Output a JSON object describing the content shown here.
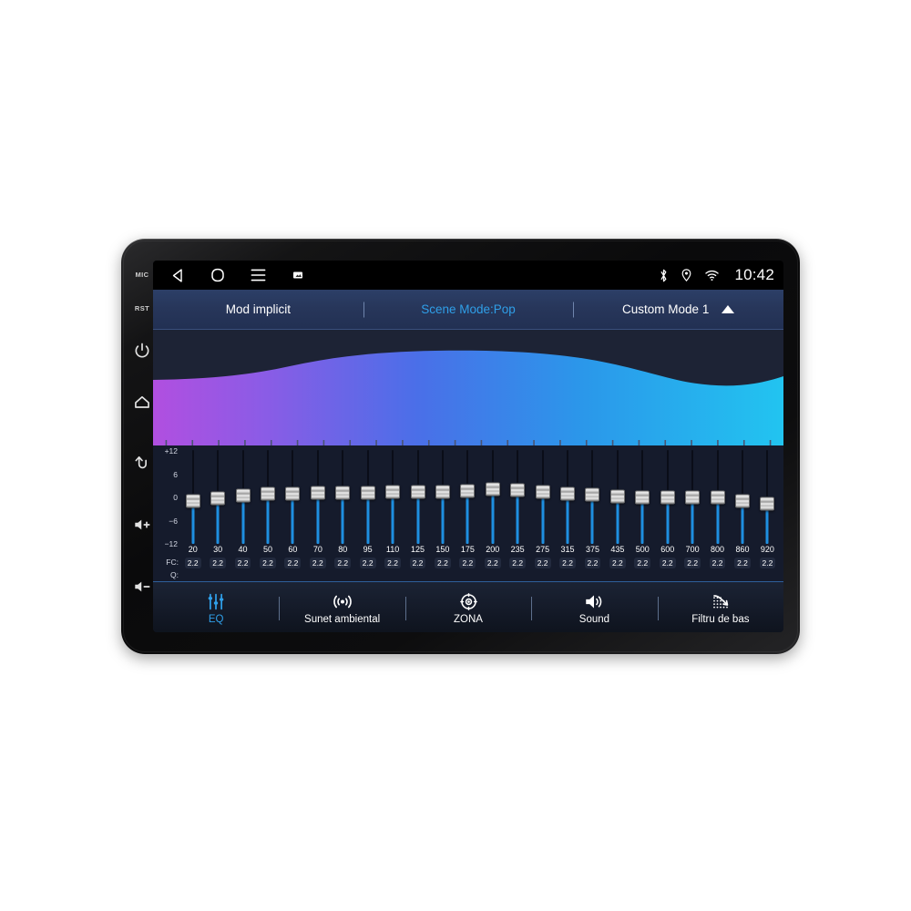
{
  "device": {
    "bezel_keys": [
      {
        "name": "mic-key",
        "label": "MIC",
        "type": "text"
      },
      {
        "name": "reset-key",
        "label": "RST",
        "type": "text"
      },
      {
        "name": "power-key",
        "label": "power-icon",
        "type": "icon"
      },
      {
        "name": "home-key",
        "label": "home-icon",
        "type": "icon"
      },
      {
        "name": "back-key",
        "label": "back-arrow-icon",
        "type": "icon"
      },
      {
        "name": "volume-up-key",
        "label": "volume-up-icon",
        "type": "icon"
      },
      {
        "name": "volume-down-key",
        "label": "volume-down-icon",
        "type": "icon"
      }
    ]
  },
  "statusbar": {
    "nav": [
      {
        "name": "android-back-button",
        "icon": "back-triangle-icon"
      },
      {
        "name": "android-home-button",
        "icon": "home-circle-icon"
      },
      {
        "name": "android-menu-button",
        "icon": "hamburger-menu-icon"
      },
      {
        "name": "android-screenshot-button",
        "icon": "screenshot-icon"
      }
    ],
    "indicators": [
      {
        "name": "bluetooth-icon"
      },
      {
        "name": "location-icon"
      },
      {
        "name": "wifi-icon"
      }
    ],
    "clock": "10:42"
  },
  "mode_row": {
    "items": [
      {
        "label": "Mod implicit",
        "active": false,
        "name": "mode-default"
      },
      {
        "label": "Scene Mode:Pop",
        "active": true,
        "name": "mode-scene"
      },
      {
        "label": "Custom Mode 1",
        "active": false,
        "name": "mode-custom-1"
      }
    ],
    "expand_icon": "triangle-up-icon"
  },
  "colors": {
    "accent": "#2f9fe8",
    "slider_fill": "#1e8fe0",
    "curve_start": "#b14fe0",
    "curve_mid": "#4a6fe8",
    "curve_end": "#22c4f0",
    "panel_bg": "#151b2c",
    "header_bg": "#27365a"
  },
  "eq": {
    "db_scale": [
      "+12",
      "6",
      "0",
      "−6",
      "−12"
    ],
    "db_range": [
      -12,
      12
    ],
    "row_label_fc": "FC:",
    "row_label_q": "Q:",
    "bands": [
      {
        "fc": "20",
        "q": "2.2",
        "gain": -1.0
      },
      {
        "fc": "30",
        "q": "2.2",
        "gain": -0.3
      },
      {
        "fc": "40",
        "q": "2.2",
        "gain": 0.4
      },
      {
        "fc": "50",
        "q": "2.2",
        "gain": 1.0
      },
      {
        "fc": "60",
        "q": "2.2",
        "gain": 1.0
      },
      {
        "fc": "70",
        "q": "2.2",
        "gain": 1.1
      },
      {
        "fc": "80",
        "q": "2.2",
        "gain": 1.2
      },
      {
        "fc": "95",
        "q": "2.2",
        "gain": 1.2
      },
      {
        "fc": "110",
        "q": "2.2",
        "gain": 1.3
      },
      {
        "fc": "125",
        "q": "2.2",
        "gain": 1.4
      },
      {
        "fc": "150",
        "q": "2.2",
        "gain": 1.4
      },
      {
        "fc": "175",
        "q": "2.2",
        "gain": 1.6
      },
      {
        "fc": "200",
        "q": "2.2",
        "gain": 2.2
      },
      {
        "fc": "235",
        "q": "2.2",
        "gain": 1.8
      },
      {
        "fc": "275",
        "q": "2.2",
        "gain": 1.5
      },
      {
        "fc": "315",
        "q": "2.2",
        "gain": 1.0
      },
      {
        "fc": "375",
        "q": "2.2",
        "gain": 0.6
      },
      {
        "fc": "435",
        "q": "2.2",
        "gain": 0.3
      },
      {
        "fc": "500",
        "q": "2.2",
        "gain": 0.1
      },
      {
        "fc": "600",
        "q": "2.2",
        "gain": 0.0
      },
      {
        "fc": "700",
        "q": "2.2",
        "gain": -0.1
      },
      {
        "fc": "800",
        "q": "2.2",
        "gain": -0.1
      },
      {
        "fc": "860",
        "q": "2.2",
        "gain": -1.0
      },
      {
        "fc": "920",
        "q": "2.2",
        "gain": -1.6
      }
    ]
  },
  "tabs": [
    {
      "label": "EQ",
      "icon": "equalizer-icon",
      "active": true,
      "name": "tab-eq"
    },
    {
      "label": "Sunet ambiental",
      "icon": "surround-sound-icon",
      "active": false,
      "name": "tab-surround"
    },
    {
      "label": "ZONA",
      "icon": "zone-target-icon",
      "active": false,
      "name": "tab-zone"
    },
    {
      "label": "Sound",
      "icon": "speaker-icon",
      "active": false,
      "name": "tab-sound"
    },
    {
      "label": "Filtru de bas",
      "icon": "bass-filter-icon",
      "active": false,
      "name": "tab-bass-filter"
    }
  ]
}
